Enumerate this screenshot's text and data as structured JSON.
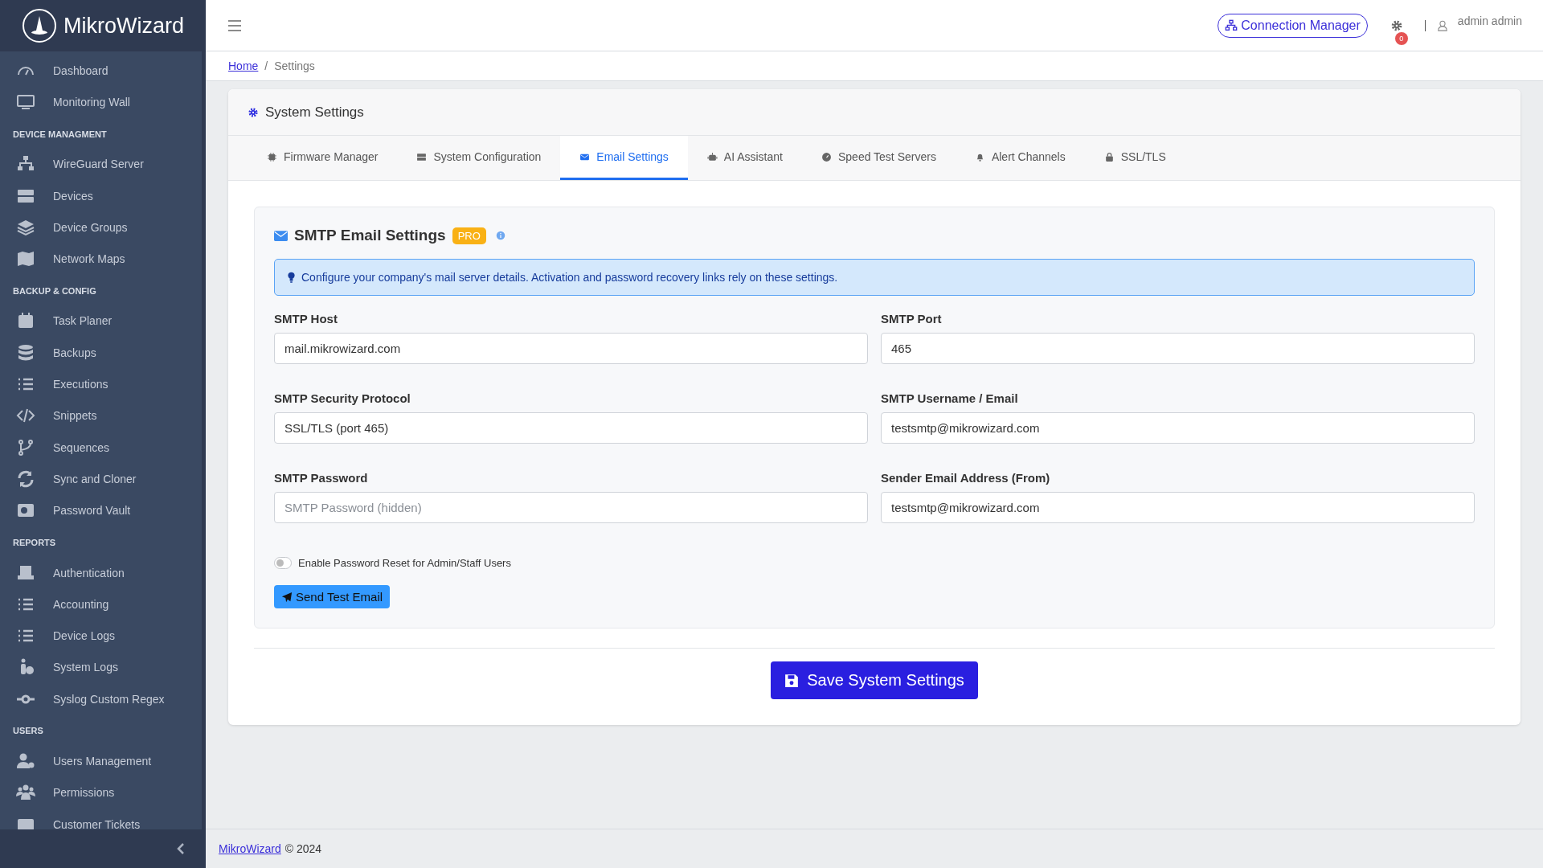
{
  "brand": {
    "name": "MikroWizard"
  },
  "sidebar": {
    "sections": [
      {
        "items": [
          {
            "label": "Dashboard"
          },
          {
            "label": "Monitoring Wall"
          }
        ]
      },
      {
        "heading": "DEVICE MANAGMENT",
        "items": [
          {
            "label": "WireGuard Server"
          },
          {
            "label": "Devices"
          },
          {
            "label": "Device Groups"
          },
          {
            "label": "Network Maps"
          }
        ]
      },
      {
        "heading": "BACKUP & CONFIG",
        "items": [
          {
            "label": "Task Planer"
          },
          {
            "label": "Backups"
          },
          {
            "label": "Executions"
          },
          {
            "label": "Snippets"
          },
          {
            "label": "Sequences"
          },
          {
            "label": "Sync and Cloner"
          },
          {
            "label": "Password Vault"
          }
        ]
      },
      {
        "heading": "REPORTS",
        "items": [
          {
            "label": "Authentication"
          },
          {
            "label": "Accounting"
          },
          {
            "label": "Device Logs"
          },
          {
            "label": "System Logs"
          },
          {
            "label": "Syslog Custom Regex"
          }
        ]
      },
      {
        "heading": "USERS",
        "items": [
          {
            "label": "Users Management"
          },
          {
            "label": "Permissions"
          },
          {
            "label": "Customer Tickets"
          }
        ]
      }
    ]
  },
  "topbar": {
    "connection_button": "Connection Manager",
    "notification_count": "0",
    "user": "admin admin"
  },
  "breadcrumb": {
    "link": "Home",
    "separator": "/",
    "current": "Settings"
  },
  "card": {
    "title": "System Settings",
    "tabs": [
      {
        "label": "Firmware Manager",
        "selected": false
      },
      {
        "label": "System Configuration",
        "selected": false
      },
      {
        "label": "Email Settings",
        "selected": true
      },
      {
        "label": "AI Assistant",
        "selected": false
      },
      {
        "label": "Speed Test Servers",
        "selected": false
      },
      {
        "label": "Alert Channels",
        "selected": false
      },
      {
        "label": "SSL/TLS",
        "selected": false
      }
    ],
    "section": {
      "title": "SMTP Email Settings",
      "badge": "PRO",
      "info": "Configure your company's mail server details. Activation and password recovery links rely on these settings.",
      "fields": [
        {
          "label": "SMTP Host",
          "value": "mail.mikrowizard.com"
        },
        {
          "label": "SMTP Port",
          "value": "465"
        },
        {
          "label": "SMTP Security Protocol",
          "value": "SSL/TLS (port 465)"
        },
        {
          "label": "SMTP Username / Email",
          "value": "testsmtp@mikrowizard.com"
        },
        {
          "label": "SMTP Password",
          "placeholder": "SMTP Password (hidden)"
        },
        {
          "label": "Sender Email Address (From)",
          "value": "testsmtp@mikrowizard.com"
        }
      ],
      "toggle": {
        "label": "Enable Password Reset for Admin/Staff Users",
        "on": false
      },
      "test_button": "Send Test Email"
    },
    "save_button": "Save System Settings"
  },
  "footer": {
    "link": "MikroWizard",
    "text": "© 2024"
  }
}
